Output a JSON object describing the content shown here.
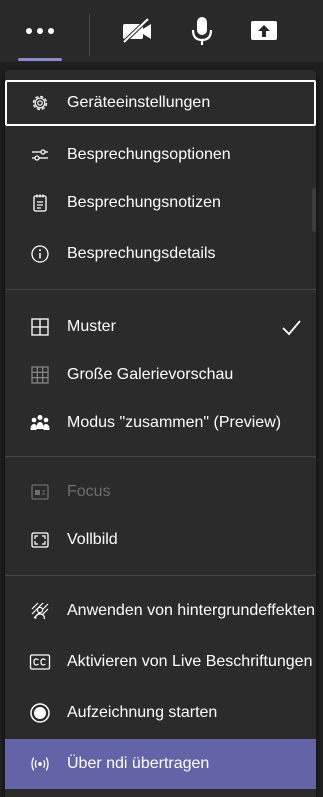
{
  "toolbar": {
    "buttons": [
      {
        "name": "more-options",
        "icon": "ellipsis-icon"
      },
      {
        "name": "camera",
        "icon": "camera-off-icon"
      },
      {
        "name": "microphone",
        "icon": "microphone-icon"
      },
      {
        "name": "share",
        "icon": "share-screen-icon"
      }
    ]
  },
  "menu": {
    "items": [
      {
        "label": "Geräteeinstellungen",
        "icon": "gear-icon",
        "state": "focused"
      },
      {
        "label": "Besprechungsoptionen",
        "icon": "sliders-icon"
      },
      {
        "label": "Besprechungsnotizen",
        "icon": "notepad-icon"
      },
      {
        "label": "Besprechungsdetails",
        "icon": "info-icon"
      },
      {
        "label": "Muster",
        "icon": "grid-icon",
        "checked": true
      },
      {
        "label": "Große Galerievorschau",
        "icon": "large-gallery-icon"
      },
      {
        "label": "Modus \"zusammen\" (Preview)",
        "icon": "people-icon"
      },
      {
        "label": "Focus",
        "icon": "focus-icon",
        "state": "disabled"
      },
      {
        "label": "Vollbild",
        "icon": "fullscreen-icon"
      },
      {
        "label": "Anwenden von hintergrundeffekten",
        "icon": "background-effects-icon"
      },
      {
        "label": "Aktivieren von Live Beschriftungen",
        "icon": "closed-captions-icon"
      },
      {
        "label": "Aufzeichnung starten",
        "icon": "record-icon"
      },
      {
        "label": "Über ndi übertragen",
        "icon": "broadcast-icon",
        "state": "active"
      }
    ]
  },
  "colors": {
    "background": "#1f1f1f",
    "menu_bg": "#2b2b2b",
    "accent": "#6264a7",
    "disabled_text": "#6e6e6e"
  }
}
